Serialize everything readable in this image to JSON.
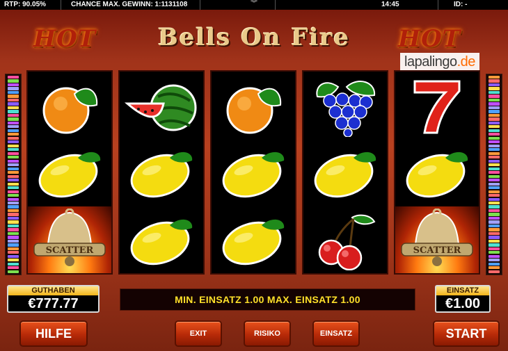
{
  "topbar": {
    "rtp": "RTP: 90.05%",
    "chance": "CHANCE MAX. GEWINN: 1:1131108",
    "time": "14:45",
    "id": "ID: -"
  },
  "game": {
    "title": "Bells On Fire",
    "hot_left": "HOT",
    "hot_right": "HOT"
  },
  "logo": {
    "main": "lapalingo",
    "tld": ".de"
  },
  "reels": [
    {
      "symbols": [
        "orange",
        "lemon",
        "bell-scatter"
      ]
    },
    {
      "symbols": [
        "watermelon",
        "lemon",
        "lemon"
      ]
    },
    {
      "symbols": [
        "orange",
        "lemon",
        "lemon"
      ]
    },
    {
      "symbols": [
        "grapes",
        "lemon",
        "cherries"
      ]
    },
    {
      "symbols": [
        "seven",
        "lemon",
        "bell-scatter"
      ]
    }
  ],
  "scatter_label": "SCATTER",
  "panel": {
    "guthaben_label": "GUTHABEN",
    "guthaben_value": "€777.77",
    "message": "MIN. EINSATZ 1.00 MAX. EINSATZ 1.00",
    "einsatz_label": "EINSATZ",
    "einsatz_value": "€1.00"
  },
  "buttons": {
    "hilfe": "HILFE",
    "exit": "EXIT",
    "risiko": "RISIKO",
    "einsatz": "EINSATZ",
    "start": "START"
  },
  "colors": {
    "frame": "#b8401f",
    "message_text": "#ffe12a",
    "button": "#c5360d"
  }
}
